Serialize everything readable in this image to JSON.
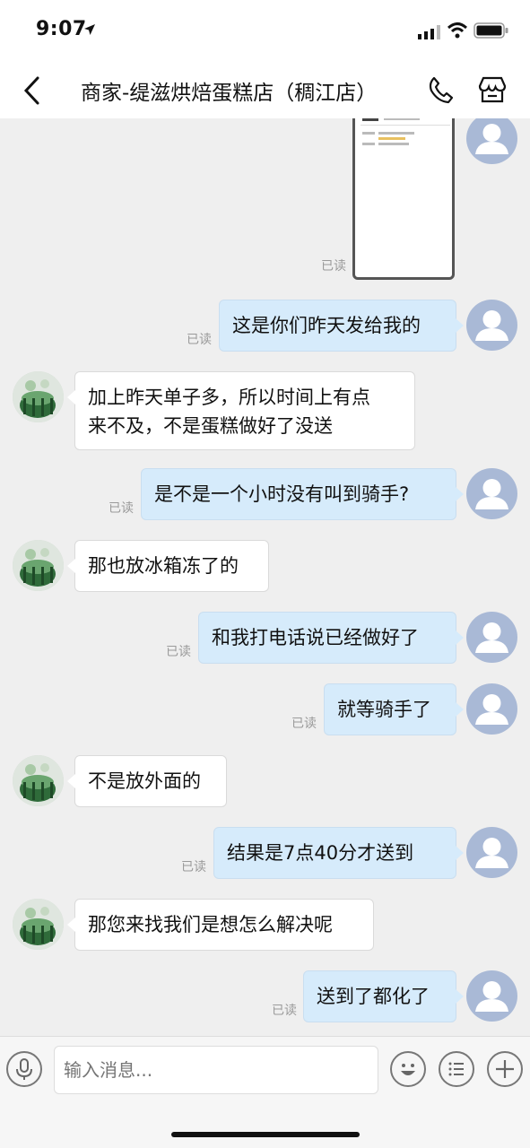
{
  "status_bar": {
    "time": "9:07"
  },
  "header": {
    "title": "商家-缇滋烘焙蛋糕店（稠江店）"
  },
  "read_label": "已读",
  "messages": [
    {
      "from": "me",
      "text": "这是你们昨天发给我的"
    },
    {
      "from": "shop",
      "line1": "加上昨天单子多，所以时间上有点",
      "line2": "来不及，不是蛋糕做好了没送"
    },
    {
      "from": "me",
      "text": "是不是一个小时没有叫到骑手?"
    },
    {
      "from": "shop",
      "text": "那也放冰箱冻了的"
    },
    {
      "from": "me",
      "text": "和我打电话说已经做好了"
    },
    {
      "from": "me",
      "text": "就等骑手了"
    },
    {
      "from": "shop",
      "text": "不是放外面的"
    },
    {
      "from": "me",
      "text": "结果是7点40分才送到"
    },
    {
      "from": "shop",
      "text": "那您来找我们是想怎么解决呢"
    },
    {
      "from": "me",
      "text": "送到了都化了"
    }
  ],
  "input": {
    "placeholder": "输入消息..."
  },
  "colors": {
    "my_bubble": "#d6ebfb",
    "shop_bubble": "#ffffff",
    "chat_bg": "#efefef",
    "my_avatar": "#a9b9d6"
  },
  "icons": [
    "location-arrow-icon",
    "signal-icon",
    "wifi-icon",
    "battery-icon",
    "back-icon",
    "phone-icon",
    "shop-icon",
    "user-avatar-icon",
    "voice-icon",
    "emoji-icon",
    "list-icon",
    "plus-icon"
  ]
}
